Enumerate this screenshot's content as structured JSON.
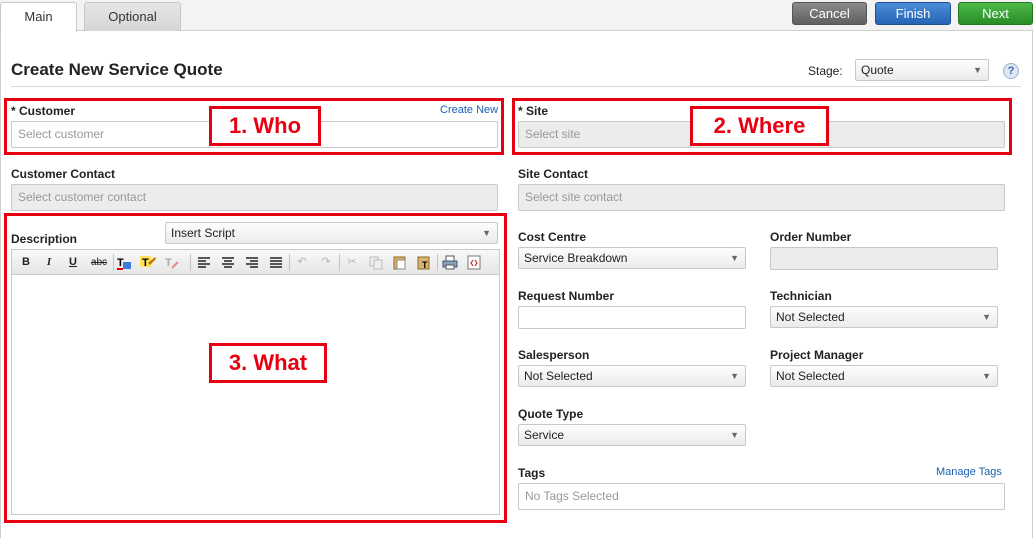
{
  "tabs": [
    {
      "label": "Main"
    },
    {
      "label": "Optional"
    }
  ],
  "actions": {
    "cancel": "Cancel",
    "finish": "Finish",
    "next": "Next"
  },
  "page": {
    "title": "Create New Service Quote",
    "stage_label": "Stage:",
    "stage_value": "Quote",
    "help": "?"
  },
  "customer": {
    "label": "* Customer",
    "create_new": "Create New",
    "placeholder": "Select customer"
  },
  "site": {
    "label": "* Site",
    "placeholder": "Select site"
  },
  "customer_contact": {
    "label": "Customer Contact",
    "placeholder": "Select customer contact"
  },
  "site_contact": {
    "label": "Site Contact",
    "placeholder": "Select site contact"
  },
  "description": {
    "label": "Description",
    "insert_script": "Insert Script",
    "toolbar": {
      "bold": "B",
      "italic": "I",
      "underline": "U",
      "strike": "abc"
    }
  },
  "cost_centre": {
    "label": "Cost Centre",
    "value": "Service Breakdown"
  },
  "order_number": {
    "label": "Order Number",
    "value": ""
  },
  "request_number": {
    "label": "Request Number",
    "value": ""
  },
  "technician": {
    "label": "Technician",
    "value": "Not Selected"
  },
  "salesperson": {
    "label": "Salesperson",
    "value": "Not Selected"
  },
  "project_manager": {
    "label": "Project Manager",
    "value": "Not Selected"
  },
  "quote_type": {
    "label": "Quote Type",
    "value": "Service"
  },
  "tags": {
    "label": "Tags",
    "manage": "Manage Tags",
    "placeholder": "No Tags Selected"
  },
  "annotations": {
    "who": "1. Who",
    "where": "2. Where",
    "what": "3. What"
  },
  "colors": {
    "annotation": "#e60012",
    "finish": "#2f6fc2",
    "next": "#36a233",
    "cancel": "#6f6f6f",
    "link": "#1a5fb4"
  }
}
